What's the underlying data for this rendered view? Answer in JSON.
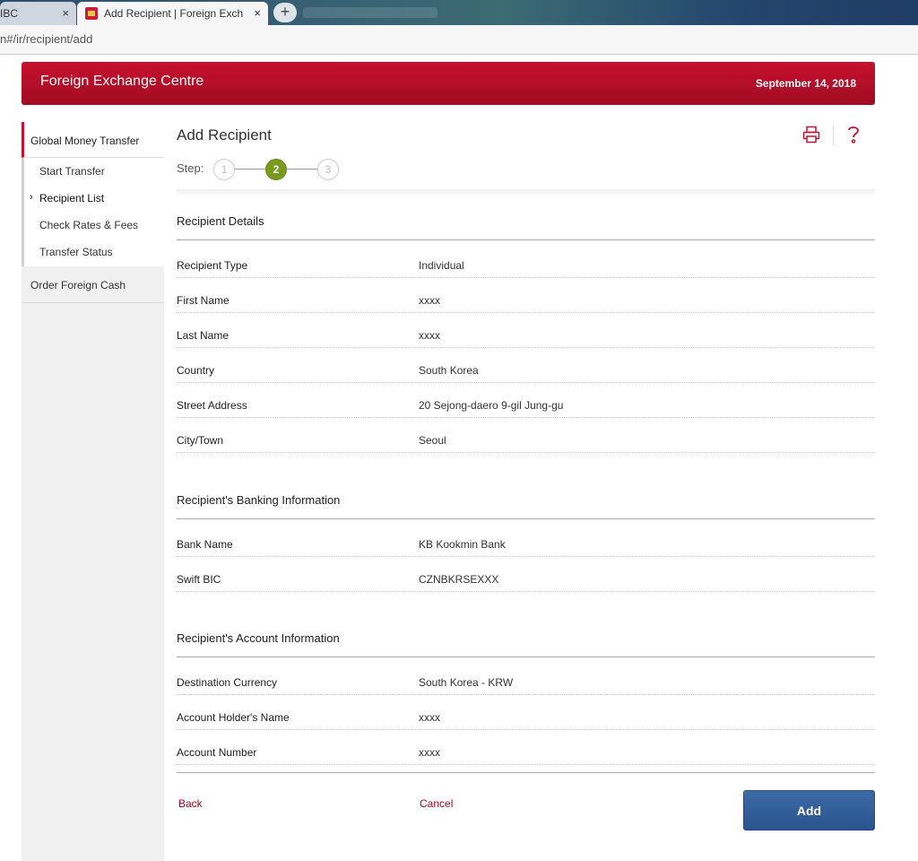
{
  "browser": {
    "tabs": [
      {
        "label": "IBC",
        "close": "×"
      },
      {
        "label": "Add Recipient | Foreign Exchange Centre",
        "close": "×"
      }
    ],
    "new_tab": "+",
    "url": "n#/ir/recipient/add"
  },
  "header": {
    "title": "Foreign Exchange Centre",
    "date": "September 14, 2018"
  },
  "sidebar": {
    "group_label": "Global Money Transfer",
    "items": [
      {
        "label": "Start Transfer",
        "current": false
      },
      {
        "label": "Recipient List",
        "current": true
      },
      {
        "label": "Check Rates & Fees",
        "current": false
      },
      {
        "label": "Transfer Status",
        "current": false
      }
    ],
    "other_label": "Order Foreign Cash",
    "caret": "›"
  },
  "main": {
    "title": "Add Recipient",
    "step_label": "Step:",
    "steps": [
      "1",
      "2",
      "3"
    ],
    "current_step": 2,
    "sections": [
      {
        "title": "Recipient Details",
        "rows": [
          {
            "label": "Recipient Type",
            "value": "Individual"
          },
          {
            "label": "First Name",
            "value": "xxxx"
          },
          {
            "label": "Last Name",
            "value": "xxxx"
          },
          {
            "label": "Country",
            "value": "South Korea"
          },
          {
            "label": "Street Address",
            "value": "20 Sejong-daero 9-gil Jung-gu"
          },
          {
            "label": "City/Town",
            "value": "Seoul"
          }
        ]
      },
      {
        "title": "Recipient's Banking Information",
        "rows": [
          {
            "label": "Bank Name",
            "value": "KB Kookmin Bank"
          },
          {
            "label": "Swift BIC",
            "value": "CZNBKRSEXXX"
          }
        ]
      },
      {
        "title": "Recipient's Account Information",
        "rows": [
          {
            "label": "Destination Currency",
            "value": "South Korea - KRW"
          },
          {
            "label": "Account Holder's Name",
            "value": "xxxx"
          },
          {
            "label": "Account Number",
            "value": "xxxx"
          }
        ]
      }
    ],
    "actions": {
      "back": "Back",
      "cancel": "Cancel",
      "add": "Add"
    }
  },
  "colors": {
    "brand_red": "#c8102e",
    "step_active": "#7a9a1e",
    "button_blue": "#2a548d",
    "link_red": "#a00c23"
  },
  "icons": [
    "close-icon",
    "plus-icon",
    "cibc-favicon",
    "printer-icon",
    "help-icon",
    "chevron-right-icon"
  ]
}
